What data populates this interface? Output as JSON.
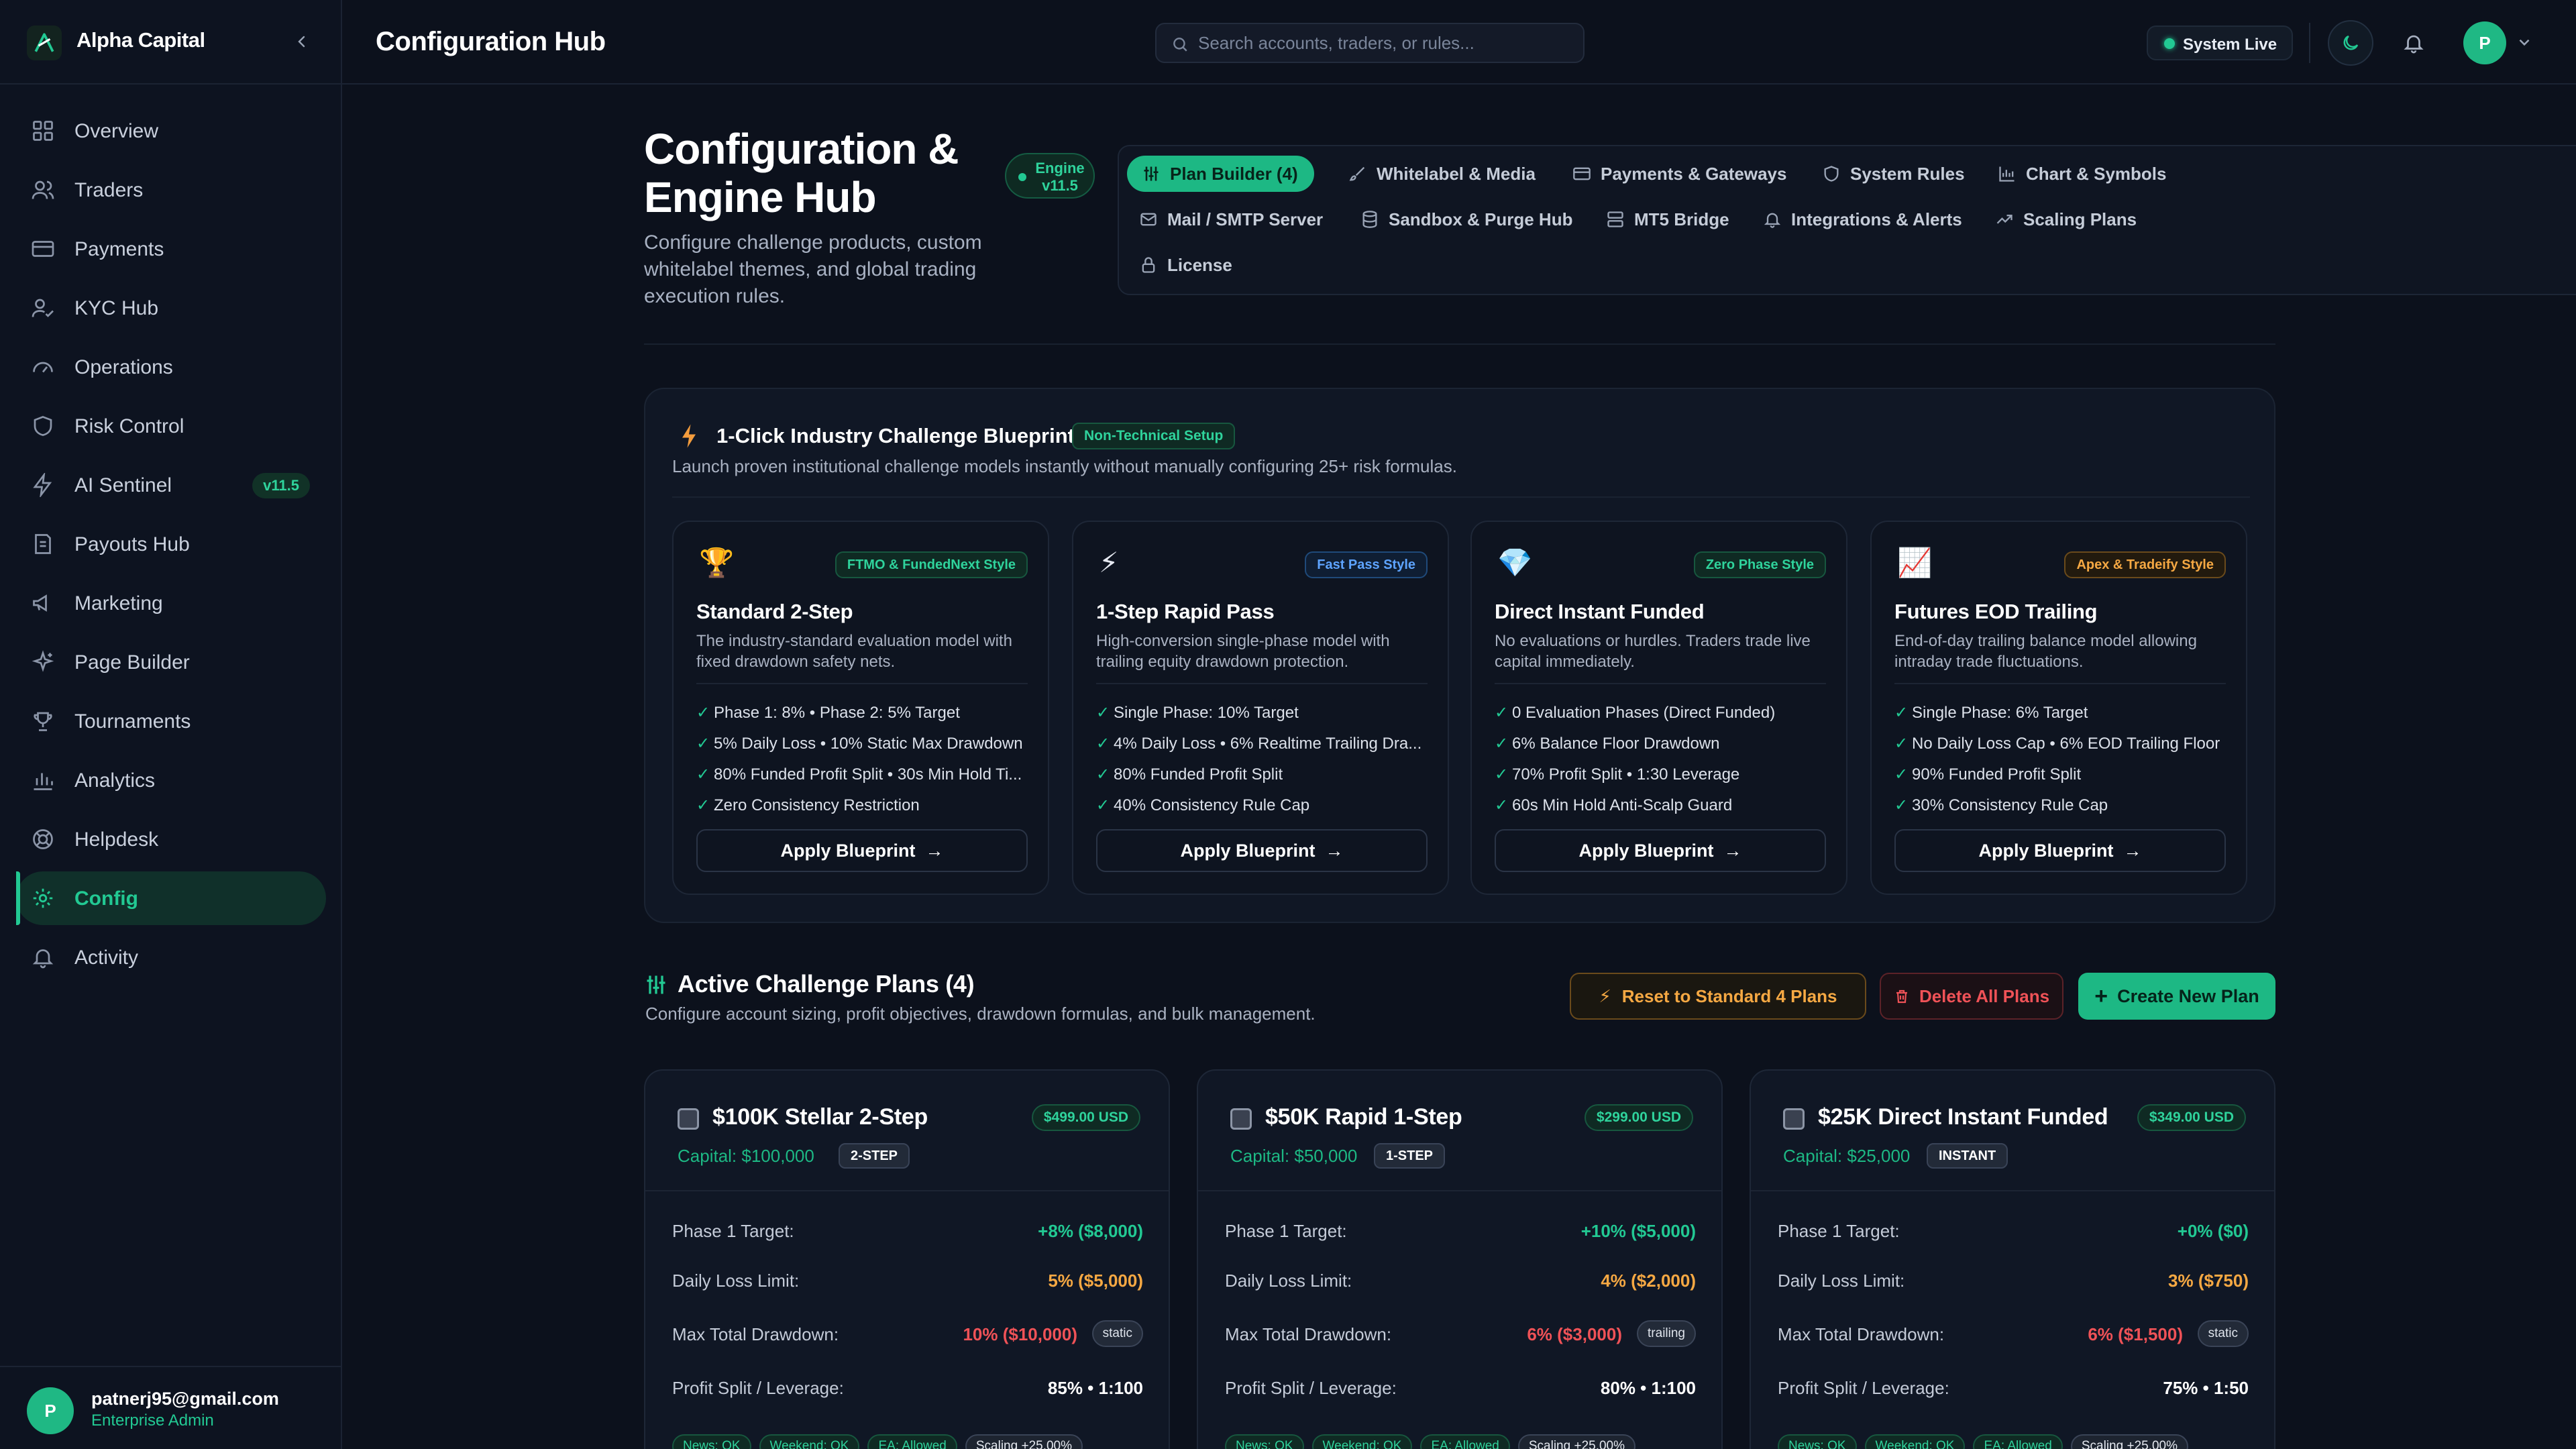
{
  "brand": {
    "name": "Alpha Capital"
  },
  "sidebar": {
    "items": [
      {
        "label": "Overview",
        "icon": "grid-icon"
      },
      {
        "label": "Traders",
        "icon": "users-icon"
      },
      {
        "label": "Payments",
        "icon": "card-icon"
      },
      {
        "label": "KYC Hub",
        "icon": "user-check-icon"
      },
      {
        "label": "Operations",
        "icon": "gauge-icon"
      },
      {
        "label": "Risk Control",
        "icon": "shield-icon"
      },
      {
        "label": "AI Sentinel",
        "icon": "bolt-icon",
        "badge": "v11.5"
      },
      {
        "label": "Payouts Hub",
        "icon": "receipt-icon"
      },
      {
        "label": "Marketing",
        "icon": "megaphone-icon"
      },
      {
        "label": "Page Builder",
        "icon": "sparkle-icon"
      },
      {
        "label": "Tournaments",
        "icon": "trophy-icon"
      },
      {
        "label": "Analytics",
        "icon": "bar-chart-icon"
      },
      {
        "label": "Helpdesk",
        "icon": "lifebuoy-icon"
      },
      {
        "label": "Config",
        "icon": "gear-icon",
        "active": true
      },
      {
        "label": "Activity",
        "icon": "bell-icon"
      }
    ],
    "user": {
      "initial": "P",
      "email": "patnerj95@gmail.com",
      "role": "Enterprise Admin"
    }
  },
  "header": {
    "title": "Configuration Hub",
    "search_placeholder": "Search accounts, traders, or rules...",
    "status": "System Live",
    "avatar_initial": "P"
  },
  "hub": {
    "title": "Configuration & Engine Hub",
    "engine_badge_line1": "Engine",
    "engine_badge_line2": "v11.5",
    "subtitle": "Configure challenge products, custom whitelabel themes, and global trading execution rules."
  },
  "tabs": [
    {
      "label": "Plan Builder (4)",
      "icon": "sliders-icon",
      "active": true
    },
    {
      "label": "Whitelabel & Media",
      "icon": "brush-icon"
    },
    {
      "label": "Payments & Gateways",
      "icon": "card-icon"
    },
    {
      "label": "System Rules",
      "icon": "shield-icon"
    },
    {
      "label": "Chart & Symbols",
      "icon": "chart-icon"
    },
    {
      "label": "Mail / SMTP Server",
      "icon": "mail-icon"
    },
    {
      "label": "Sandbox & Purge Hub",
      "icon": "database-icon"
    },
    {
      "label": "MT5 Bridge",
      "icon": "server-icon"
    },
    {
      "label": "Integrations & Alerts",
      "icon": "bell-icon"
    },
    {
      "label": "Scaling Plans",
      "icon": "trend-up-icon"
    },
    {
      "label": "License",
      "icon": "lock-icon"
    }
  ],
  "blueprints": {
    "title": "1-Click Industry Challenge Blueprints",
    "tag": "Non-Technical Setup",
    "subtitle": "Launch proven institutional challenge models instantly without manually configuring 25+ risk formulas.",
    "apply_label": "Apply Blueprint",
    "cards": [
      {
        "emoji": "🏆",
        "tag": "FTMO & FundedNext Style",
        "name": "Standard 2-Step",
        "desc": "The industry-standard evaluation model with fixed drawdown safety nets.",
        "features": [
          "Phase 1: 8% • Phase 2: 5% Target",
          "5% Daily Loss • 10% Static Max Drawdown",
          "80% Funded Profit Split • 30s Min Hold Ti...",
          "Zero Consistency Restriction"
        ]
      },
      {
        "emoji": "⚡",
        "tag": "Fast Pass Style",
        "name": "1-Step Rapid Pass",
        "desc": "High-conversion single-phase model with trailing equity drawdown protection.",
        "features": [
          "Single Phase: 10% Target",
          "4% Daily Loss • 6% Realtime Trailing Dra...",
          "80% Funded Profit Split",
          "40% Consistency Rule Cap"
        ]
      },
      {
        "emoji": "💎",
        "tag": "Zero Phase Style",
        "name": "Direct Instant Funded",
        "desc": "No evaluations or hurdles. Traders trade live capital immediately.",
        "features": [
          "0 Evaluation Phases (Direct Funded)",
          "6% Balance Floor Drawdown",
          "70% Profit Split • 1:30 Leverage",
          "60s Min Hold Anti-Scalp Guard"
        ]
      },
      {
        "emoji": "📈",
        "tag": "Apex & Tradeify Style",
        "name": "Futures EOD Trailing",
        "desc": "End-of-day trailing balance model allowing intraday trade fluctuations.",
        "features": [
          "Single Phase: 6% Target",
          "No Daily Loss Cap • 6% EOD Trailing Floor",
          "90% Funded Profit Split",
          "30% Consistency Rule Cap"
        ]
      }
    ]
  },
  "active_plans": {
    "title": "Active Challenge Plans (4)",
    "subtitle": "Configure account sizing, profit objectives, drawdown formulas, and bulk management.",
    "reset_label": "Reset to Standard 4 Plans",
    "delete_label": "Delete All Plans",
    "create_label": "Create New Plan",
    "labels": {
      "target": "Phase 1 Target:",
      "daily": "Daily Loss Limit:",
      "maxdd": "Max Total Drawdown:",
      "split": "Profit Split / Leverage:"
    },
    "plans": [
      {
        "name": "$100K Stellar 2-Step",
        "price": "$499.00 USD",
        "capital": "Capital: $100,000",
        "type": "2-STEP",
        "target": "+8% ($8,000)",
        "daily": "5% ($5,000)",
        "maxdd": "10% ($10,000)",
        "dd_type": "static",
        "split": "85% • 1:100",
        "chips": [
          "News: OK",
          "Weekend: OK",
          "EA: Allowed",
          "Scaling +25.00%"
        ]
      },
      {
        "name": "$50K Rapid 1-Step",
        "price": "$299.00 USD",
        "capital": "Capital: $50,000",
        "type": "1-STEP",
        "target": "+10% ($5,000)",
        "daily": "4% ($2,000)",
        "maxdd": "6% ($3,000)",
        "dd_type": "trailing",
        "split": "80% • 1:100",
        "chips": [
          "News: OK",
          "Weekend: OK",
          "EA: Allowed",
          "Scaling +25.00%"
        ]
      },
      {
        "name": "$25K Direct Instant Funded",
        "price": "$349.00 USD",
        "capital": "Capital: $25,000",
        "type": "INSTANT",
        "target": "+0% ($0)",
        "daily": "3% ($750)",
        "maxdd": "6% ($1,500)",
        "dd_type": "static",
        "split": "75% • 1:50",
        "chips": [
          "News: OK",
          "Weekend: OK",
          "EA: Allowed",
          "Scaling +25.00%"
        ]
      }
    ]
  }
}
